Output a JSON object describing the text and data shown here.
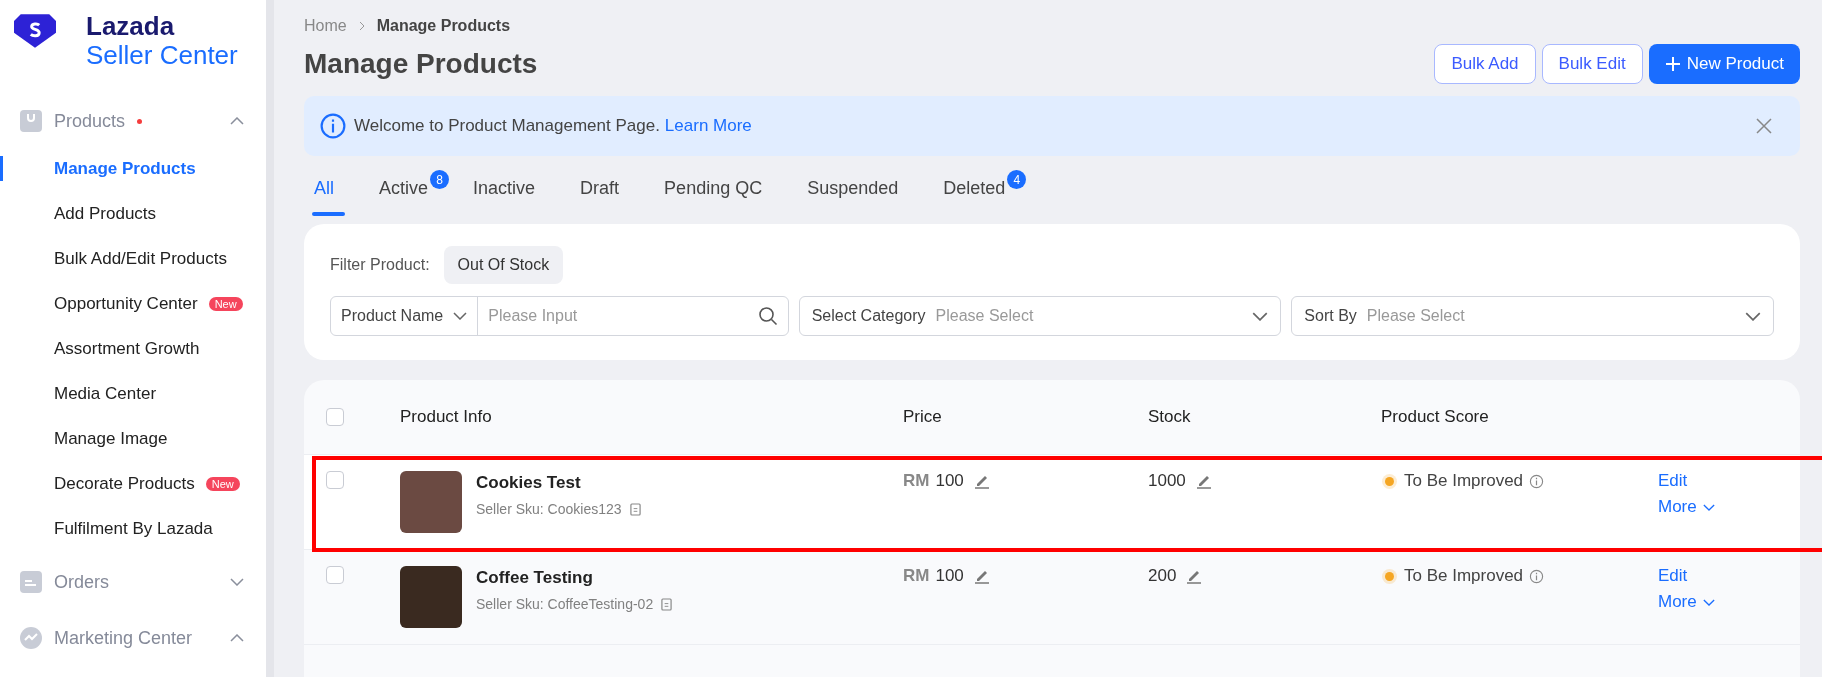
{
  "logo": {
    "line1": "Lazada",
    "line2": "Seller Center"
  },
  "sidebar": {
    "items": [
      {
        "label": "Products",
        "dot": true,
        "expanded": true,
        "children": [
          {
            "label": "Manage Products",
            "selected": true
          },
          {
            "label": "Add Products",
            "selected": false
          },
          {
            "label": "Bulk Add/Edit Products",
            "selected": false
          },
          {
            "label": "Opportunity Center",
            "selected": false,
            "badge": "New"
          },
          {
            "label": "Assortment Growth",
            "selected": false
          },
          {
            "label": "Media Center",
            "selected": false
          },
          {
            "label": "Manage Image",
            "selected": false
          },
          {
            "label": "Decorate Products",
            "selected": false,
            "badge": "New"
          },
          {
            "label": "Fulfilment By Lazada",
            "selected": false
          }
        ]
      },
      {
        "label": "Orders",
        "dot": false,
        "expanded": false
      },
      {
        "label": "Marketing Center",
        "dot": false,
        "expanded": true
      }
    ]
  },
  "breadcrumb": [
    "Home",
    "Manage Products"
  ],
  "page_title": "Manage Products",
  "actions": [
    {
      "label": "Bulk Add",
      "kind": "outline"
    },
    {
      "label": "Bulk Edit",
      "kind": "outline"
    },
    {
      "label": "New Product",
      "kind": "primary"
    }
  ],
  "notice": {
    "text": "Welcome to Product Management Page.",
    "link": "Learn More"
  },
  "tabs": [
    {
      "label": "All",
      "selected": true
    },
    {
      "label": "Active",
      "count": "8",
      "selected": false
    },
    {
      "label": "Inactive",
      "selected": false
    },
    {
      "label": "Draft",
      "selected": false
    },
    {
      "label": "Pending QC",
      "selected": false
    },
    {
      "label": "Suspended",
      "selected": false
    },
    {
      "label": "Deleted",
      "count": "4",
      "selected": false
    }
  ],
  "filter": {
    "label": "Filter Product:",
    "chips": [
      "Out Of Stock"
    ],
    "search_type": "Product Name",
    "search_placeholder": "Please Input",
    "category_label": "Select Category",
    "category_placeholder": "Please Select",
    "sort_label": "Sort By",
    "sort_placeholder": "Please Select"
  },
  "table": {
    "select_all_checked": false,
    "columns": [
      "Product Info",
      "Price",
      "Stock",
      "Product Score"
    ],
    "rows": [
      {
        "checked": false,
        "highlighted": true,
        "name": "Cookies Test",
        "sku": "Seller Sku: Cookies123",
        "currency": "RM",
        "price": "100",
        "stock": "1000",
        "score": "To Be Improved",
        "color": "#f5a623",
        "actions": [
          "Edit",
          "More"
        ]
      },
      {
        "checked": false,
        "highlighted": false,
        "name": "Coffee Testing",
        "sku": "Seller Sku: CoffeeTesting-02",
        "currency": "RM",
        "price": "100",
        "stock": "200",
        "score": "To Be Improved",
        "color": "#f5a623",
        "actions": [
          "Edit",
          "More"
        ]
      }
    ]
  }
}
